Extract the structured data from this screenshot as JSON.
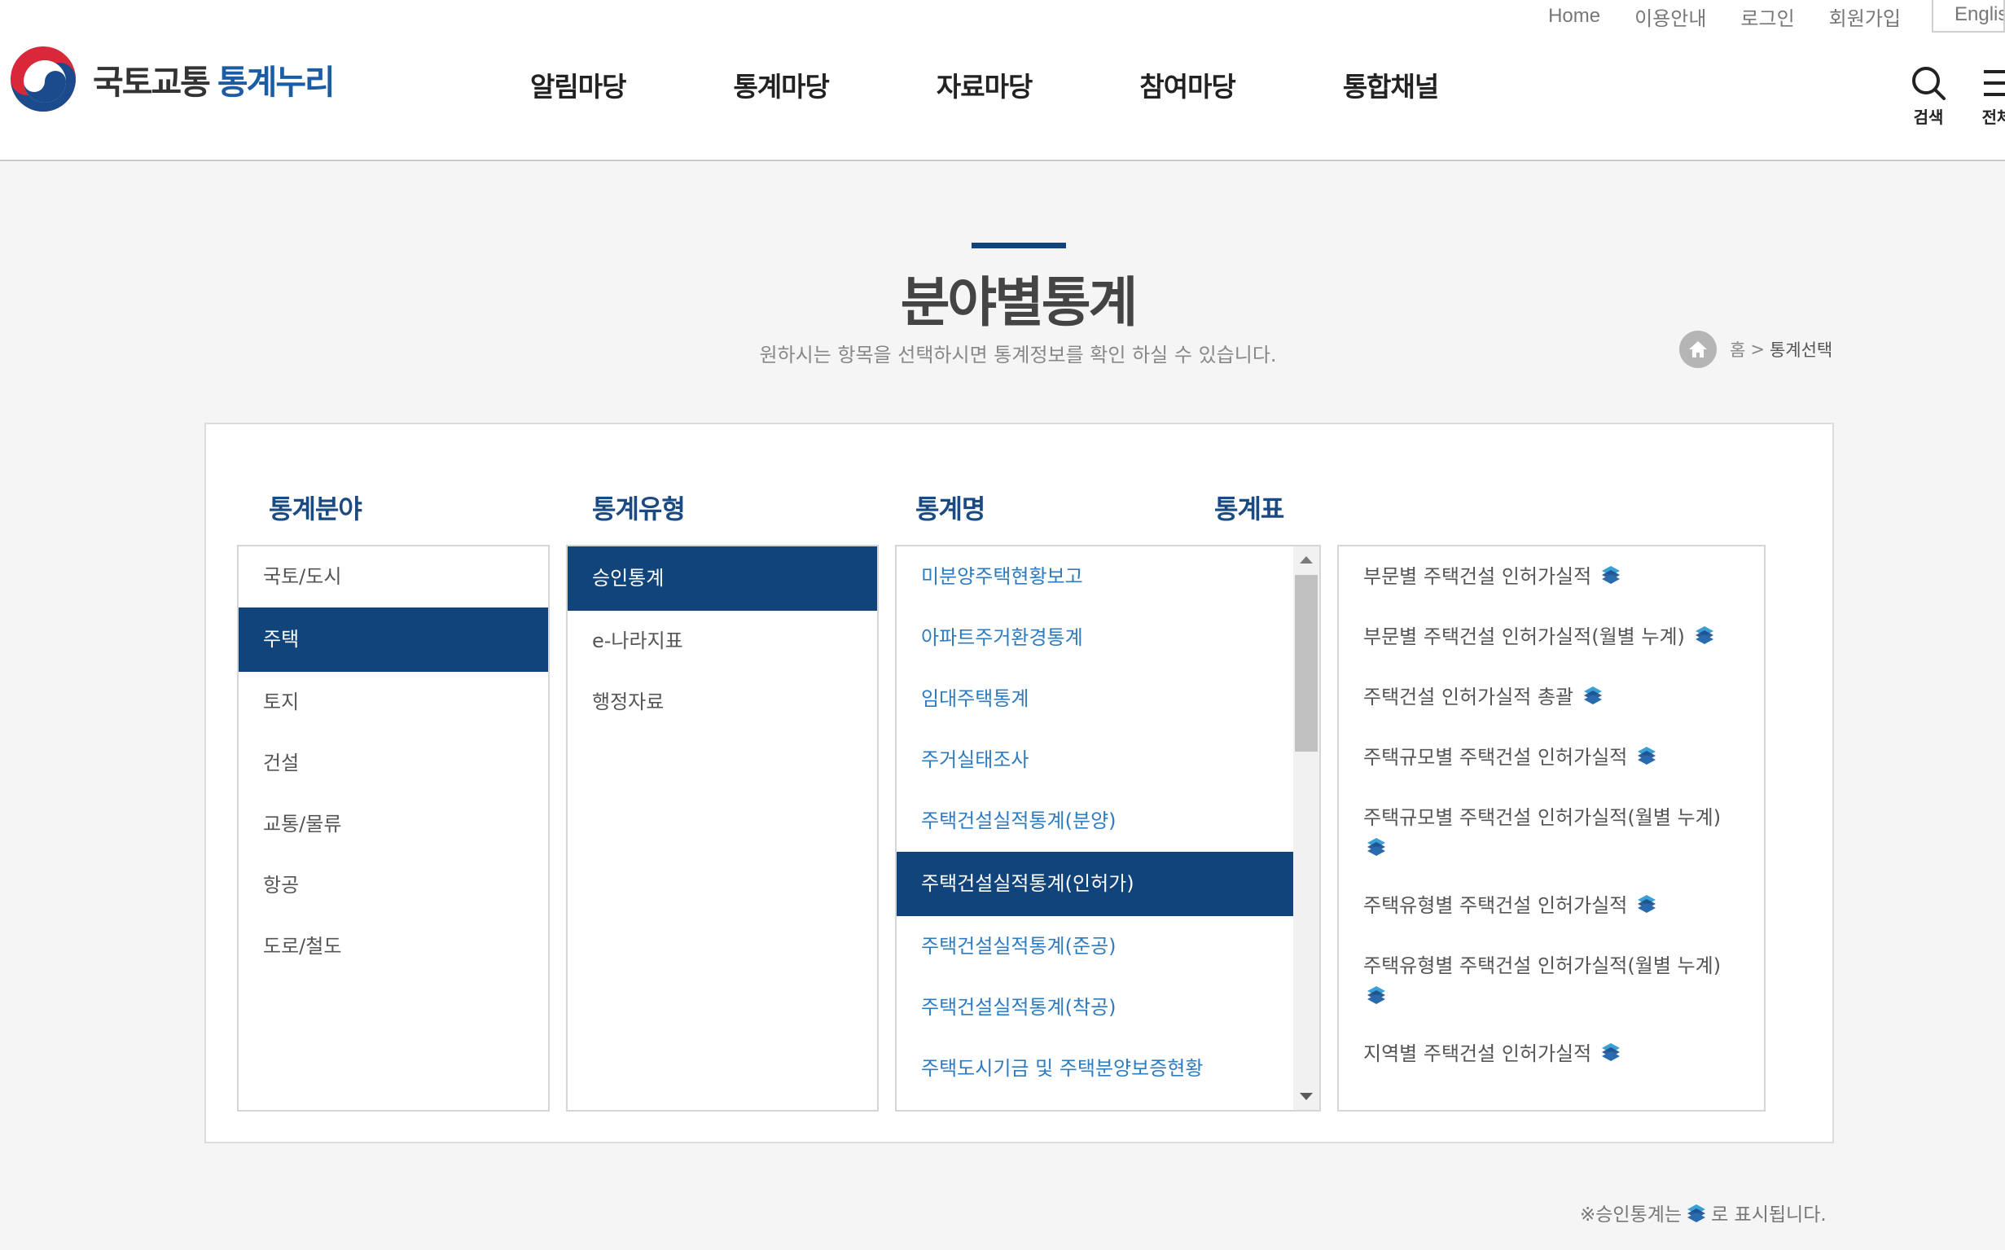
{
  "util_links": [
    "Home",
    "이용안내",
    "로그인",
    "회원가입"
  ],
  "util_lang": "English",
  "logo": {
    "part1": "국토교통",
    "part2": "통계누리"
  },
  "gnb": [
    "알림마당",
    "통계마당",
    "자료마당",
    "참여마당",
    "통합채널"
  ],
  "header_buttons": {
    "search": "검색",
    "all_menu": "전체"
  },
  "page": {
    "title": "분야별통계",
    "subtitle": "원하시는 항목을 선택하시면 통계정보를 확인 하실 수 있습니다.",
    "breadcrumb": {
      "home": "홈",
      "current": "통계선택"
    }
  },
  "columns": {
    "field": "통계분야",
    "type": "통계유형",
    "name": "통계명",
    "table": "통계표"
  },
  "fields": [
    "국토/도시",
    "주택",
    "토지",
    "건설",
    "교통/물류",
    "항공",
    "도로/철도"
  ],
  "selected_field": "주택",
  "types": [
    "승인통계",
    "e-나라지표",
    "행정자료"
  ],
  "selected_type": "승인통계",
  "stat_names": [
    "미분양주택현황보고",
    "아파트주거환경통계",
    "임대주택통계",
    "주거실태조사",
    "주택건설실적통계(분양)",
    "주택건설실적통계(인허가)",
    "주택건설실적통계(준공)",
    "주택건설실적통계(착공)",
    "주택도시기금 및 주택분양보증현황"
  ],
  "selected_stat_name": "주택건설실적통계(인허가)",
  "stat_tables": [
    "부문별 주택건설 인허가실적",
    "부문별 주택건설 인허가실적(월별 누계)",
    "주택건설 인허가실적 총괄",
    "주택규모별 주택건설 인허가실적",
    "주택규모별 주택건설 인허가실적(월별 누계)",
    "주택유형별 주택건설 인허가실적",
    "주택유형별 주택건설 인허가실적(월별 누계)",
    "지역별 주택건설 인허가실적"
  ],
  "footnote": {
    "before": "※승인통계는",
    "after": "로 표시됩니다."
  },
  "colors": {
    "primary": "#12447c",
    "link": "#2e7bbf",
    "approved_icon": "#2a6bb0"
  }
}
